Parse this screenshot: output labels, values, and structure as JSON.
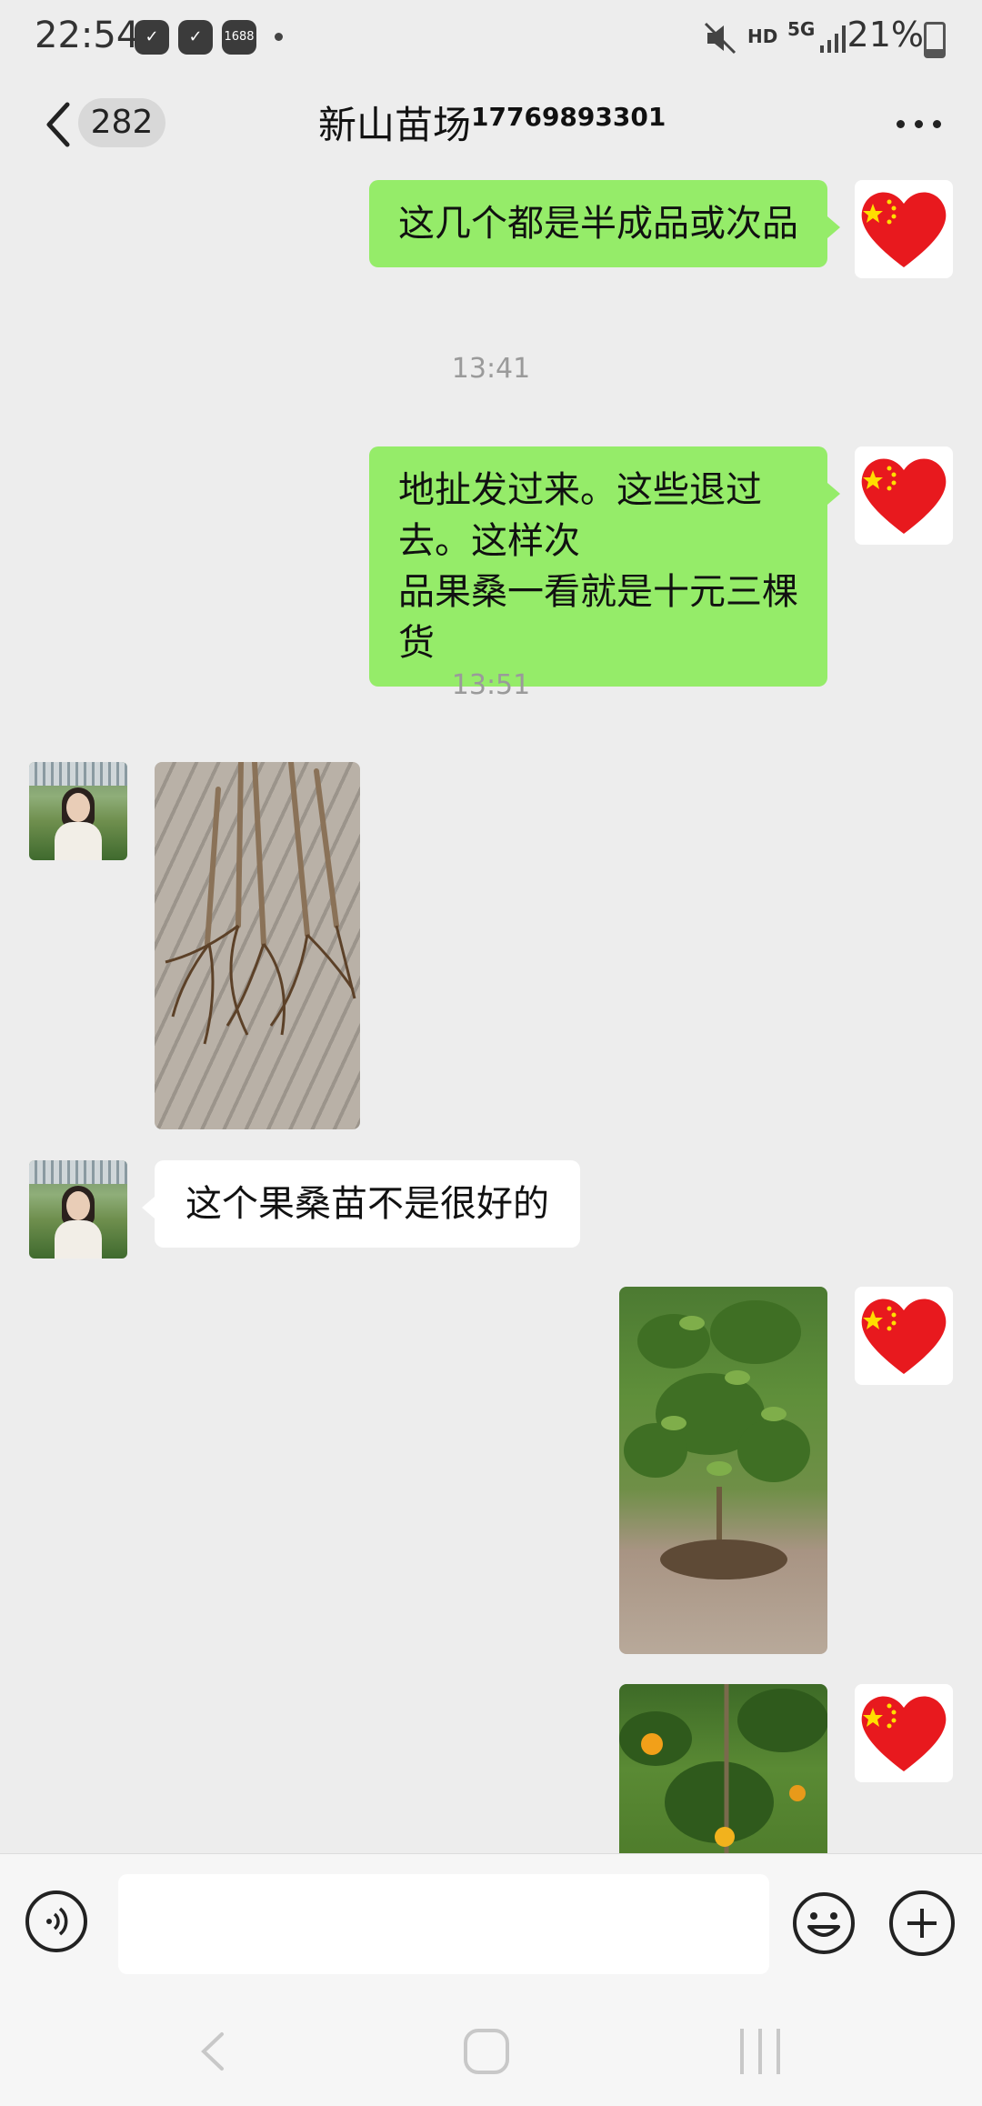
{
  "status_bar": {
    "time": "22:54",
    "icons": [
      "chat-app-icon",
      "chat-app-icon",
      "1688-app-icon"
    ],
    "app_1688_label": "1688",
    "network": "5G",
    "hd": "HD",
    "battery": "21%"
  },
  "header": {
    "unread_count": "282",
    "title": "新山苗场",
    "phone": "17769893301"
  },
  "messages": [
    {
      "type": "text",
      "side": "mine",
      "text": "这几个都是半成品或次品"
    },
    {
      "type": "time",
      "text": "13:41"
    },
    {
      "type": "text",
      "side": "mine",
      "line1": "地扯发过来。这些退过去。这样次",
      "line2": "品果桑一看就是十元三棵货"
    },
    {
      "type": "time",
      "text": "13:51"
    },
    {
      "type": "image",
      "side": "other",
      "subject": "seedling roots"
    },
    {
      "type": "text",
      "side": "other",
      "text": "这个果桑苗不是很好的"
    },
    {
      "type": "image",
      "side": "mine",
      "subject": "tree seedling"
    },
    {
      "type": "image",
      "side": "mine",
      "subject": "orange tree"
    }
  ],
  "input": {
    "value": "",
    "placeholder": ""
  },
  "colors": {
    "mine_bubble": "#95ec69",
    "other_bubble": "#ffffff",
    "background": "#ededed"
  }
}
